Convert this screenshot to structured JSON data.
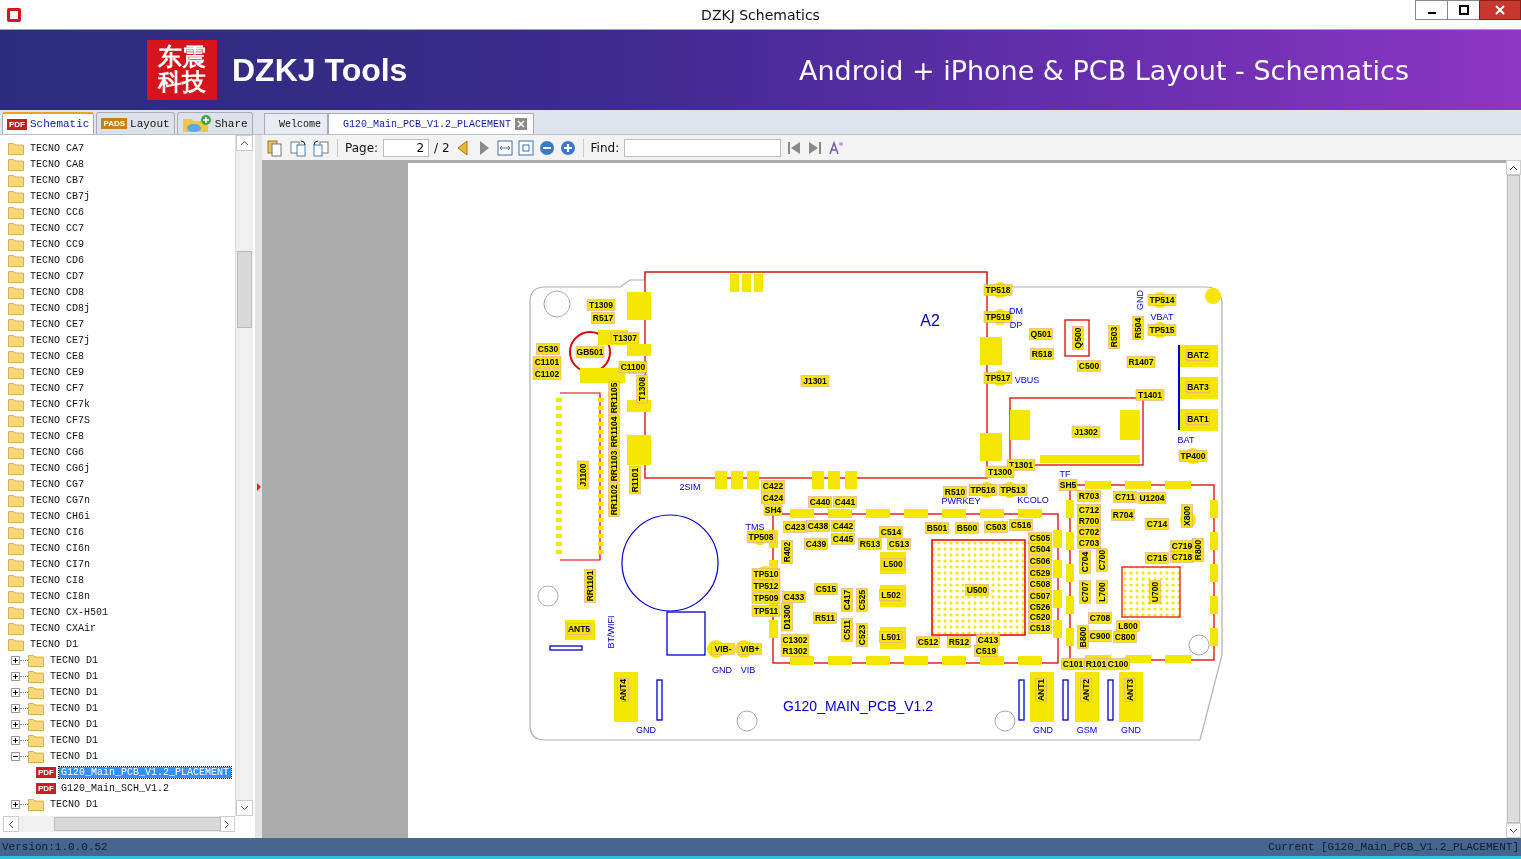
{
  "window": {
    "title": "DZKJ Schematics"
  },
  "banner": {
    "logo": "东震科技",
    "brand": "DZKJ Tools",
    "tagline": "Android + iPhone & PCB Layout - Schematics"
  },
  "panel_tabs": [
    {
      "kind": "schematic",
      "badge": "PDF",
      "label": "Schematic",
      "selected": true
    },
    {
      "kind": "layout",
      "badge": "PADS",
      "label": "Layout",
      "selected": false
    },
    {
      "kind": "share",
      "label": "Share",
      "selected": false
    }
  ],
  "document_tabs": [
    {
      "label": "Welcome",
      "selected": false,
      "closable": false
    },
    {
      "label": "G120_Main_PCB_V1.2_PLACEMENT",
      "selected": true,
      "closable": true
    }
  ],
  "tree": [
    {
      "kind": "folder",
      "label": "TECNO CA7",
      "selected": false
    },
    {
      "kind": "folder",
      "label": "TECNO CA8",
      "selected": false
    },
    {
      "kind": "folder",
      "label": "TECNO CB7",
      "selected": false
    },
    {
      "kind": "folder",
      "label": "TECNO CB7j",
      "selected": false
    },
    {
      "kind": "folder",
      "label": "TECNO CC6",
      "selected": false
    },
    {
      "kind": "folder",
      "label": "TECNO CC7",
      "selected": false
    },
    {
      "kind": "folder",
      "label": "TECNO CC9",
      "selected": false
    },
    {
      "kind": "folder",
      "label": "TECNO CD6",
      "selected": false
    },
    {
      "kind": "folder",
      "label": "TECNO CD7",
      "selected": false
    },
    {
      "kind": "folder",
      "label": "TECNO CD8",
      "selected": false
    },
    {
      "kind": "folder",
      "label": "TECNO CD8j",
      "selected": false
    },
    {
      "kind": "folder",
      "label": "TECNO CE7",
      "selected": false
    },
    {
      "kind": "folder",
      "label": "TECNO CE7j",
      "selected": false
    },
    {
      "kind": "folder",
      "label": "TECNO CE8",
      "selected": false
    },
    {
      "kind": "folder",
      "label": "TECNO CE9",
      "selected": false
    },
    {
      "kind": "folder",
      "label": "TECNO CF7",
      "selected": false
    },
    {
      "kind": "folder",
      "label": "TECNO CF7k",
      "selected": false
    },
    {
      "kind": "folder",
      "label": "TECNO CF7S",
      "selected": false
    },
    {
      "kind": "folder",
      "label": "TECNO CF8",
      "selected": false
    },
    {
      "kind": "folder",
      "label": "TECNO CG6",
      "selected": false
    },
    {
      "kind": "folder",
      "label": "TECNO CG6j",
      "selected": false
    },
    {
      "kind": "folder",
      "label": "TECNO CG7",
      "selected": false
    },
    {
      "kind": "folder",
      "label": "TECNO CG7n",
      "selected": false
    },
    {
      "kind": "folder",
      "label": "TECNO CH6i",
      "selected": false
    },
    {
      "kind": "folder",
      "label": "TECNO CI6",
      "selected": false
    },
    {
      "kind": "folder",
      "label": "TECNO CI6n",
      "selected": false
    },
    {
      "kind": "folder",
      "label": "TECNO CI7n",
      "selected": false
    },
    {
      "kind": "folder",
      "label": "TECNO CI8",
      "selected": false
    },
    {
      "kind": "folder",
      "label": "TECNO CI8n",
      "selected": false
    },
    {
      "kind": "folder",
      "label": "TECNO CX-H501",
      "selected": false
    },
    {
      "kind": "folder",
      "label": "TECNO CXAir",
      "selected": false
    },
    {
      "kind": "folder",
      "label": "TECNO D1",
      "selected": false,
      "children": [
        {
          "kind": "folder",
          "label": "TECNO D1",
          "expanded": false,
          "selected": false
        },
        {
          "kind": "folder",
          "label": "TECNO D1",
          "expanded": false,
          "selected": false
        },
        {
          "kind": "folder",
          "label": "TECNO D1",
          "expanded": false,
          "selected": false
        },
        {
          "kind": "folder",
          "label": "TECNO D1",
          "expanded": false,
          "selected": false
        },
        {
          "kind": "folder",
          "label": "TECNO D1",
          "expanded": false,
          "selected": false
        },
        {
          "kind": "folder",
          "label": "TECNO D1",
          "expanded": false,
          "selected": false
        },
        {
          "kind": "folder",
          "label": "TECNO D1",
          "expanded": true,
          "selected": false,
          "children": [
            {
              "kind": "file",
              "badge": "PDF",
              "label": "G120_Main_PCB_V1.2_PLACEMENT",
              "selected": true
            },
            {
              "kind": "file",
              "badge": "PDF",
              "label": "G120_Main_SCH_V1.2",
              "selected": false
            }
          ]
        },
        {
          "kind": "folder",
          "label": "TECNO D1",
          "expanded": false,
          "selected": false
        }
      ]
    }
  ],
  "toolbar": {
    "page_label": "Page:",
    "page": "2",
    "page_total": "/ 2",
    "find_label": "Find:"
  },
  "document": {
    "labels": [
      {
        "text": "T1309",
        "kind": "part"
      },
      {
        "text": "R517",
        "kind": "part"
      },
      {
        "text": "T1307",
        "kind": "part"
      },
      {
        "text": "GB501",
        "kind": "part"
      },
      {
        "text": "C530",
        "kind": "part"
      },
      {
        "text": "C1101",
        "kind": "part"
      },
      {
        "text": "C1102",
        "kind": "part"
      },
      {
        "text": "C1100",
        "kind": "part"
      },
      {
        "text": "T1308",
        "kind": "part"
      },
      {
        "text": "J1301",
        "kind": "part"
      },
      {
        "text": "A2",
        "kind": "net"
      },
      {
        "text": "J1100",
        "kind": "part"
      },
      {
        "text": "RR1105",
        "kind": "part"
      },
      {
        "text": "RR1104",
        "kind": "part"
      },
      {
        "text": "RR1103",
        "kind": "part"
      },
      {
        "text": "RR1102",
        "kind": "part"
      },
      {
        "text": "R1101",
        "kind": "part"
      },
      {
        "text": "RR1101",
        "kind": "part"
      },
      {
        "text": "2SIM",
        "kind": "net"
      },
      {
        "text": "BT/WIFI",
        "kind": "net"
      },
      {
        "text": "ANT5",
        "kind": "part"
      },
      {
        "text": "ANT4",
        "kind": "part"
      },
      {
        "text": "GND",
        "kind": "net"
      },
      {
        "text": "VIB-",
        "kind": "part"
      },
      {
        "text": "VIB+",
        "kind": "part"
      },
      {
        "text": "GND",
        "kind": "net"
      },
      {
        "text": "VIB",
        "kind": "net"
      },
      {
        "text": "G120_MAIN_PCB_V1.2",
        "kind": "net"
      },
      {
        "text": "TP518",
        "kind": "part"
      },
      {
        "text": "TP519",
        "kind": "part"
      },
      {
        "text": "DM",
        "kind": "net"
      },
      {
        "text": "DP",
        "kind": "net"
      },
      {
        "text": "TP517",
        "kind": "part"
      },
      {
        "text": "VBUS",
        "kind": "net"
      },
      {
        "text": "Q501",
        "kind": "part"
      },
      {
        "text": "R518",
        "kind": "part"
      },
      {
        "text": "Q500",
        "kind": "part"
      },
      {
        "text": "R503",
        "kind": "part"
      },
      {
        "text": "R504",
        "kind": "part"
      },
      {
        "text": "GND",
        "kind": "net"
      },
      {
        "text": "TP514",
        "kind": "part"
      },
      {
        "text": "VBAT",
        "kind": "net"
      },
      {
        "text": "TP515",
        "kind": "part"
      },
      {
        "text": "R1407",
        "kind": "part"
      },
      {
        "text": "C500",
        "kind": "part"
      },
      {
        "text": "T1401",
        "kind": "part"
      },
      {
        "text": "BAT2",
        "kind": "part"
      },
      {
        "text": "BAT3",
        "kind": "part"
      },
      {
        "text": "BAT1",
        "kind": "part"
      },
      {
        "text": "J1302",
        "kind": "part"
      },
      {
        "text": "BAT",
        "kind": "net"
      },
      {
        "text": "TP400",
        "kind": "part"
      },
      {
        "text": "T1301",
        "kind": "part"
      },
      {
        "text": "T1300",
        "kind": "part"
      },
      {
        "text": "TF",
        "kind": "net"
      },
      {
        "text": "SH5",
        "kind": "part"
      },
      {
        "text": "PWRKEY",
        "kind": "net"
      },
      {
        "text": "KCOLO",
        "kind": "net"
      },
      {
        "text": "R510",
        "kind": "part"
      },
      {
        "text": "TP516",
        "kind": "part"
      },
      {
        "text": "TP513",
        "kind": "part"
      },
      {
        "text": "C422",
        "kind": "part"
      },
      {
        "text": "C424",
        "kind": "part"
      },
      {
        "text": "SH4",
        "kind": "part"
      },
      {
        "text": "C440",
        "kind": "part"
      },
      {
        "text": "C441",
        "kind": "part"
      },
      {
        "text": "TMS",
        "kind": "net"
      },
      {
        "text": "TP508",
        "kind": "part"
      },
      {
        "text": "TP510",
        "kind": "part"
      },
      {
        "text": "TP512",
        "kind": "part"
      },
      {
        "text": "TP509",
        "kind": "part"
      },
      {
        "text": "TP511",
        "kind": "part"
      },
      {
        "text": "C423",
        "kind": "part"
      },
      {
        "text": "C438",
        "kind": "part"
      },
      {
        "text": "C442",
        "kind": "part"
      },
      {
        "text": "C439",
        "kind": "part"
      },
      {
        "text": "C445",
        "kind": "part"
      },
      {
        "text": "R402",
        "kind": "part"
      },
      {
        "text": "C433",
        "kind": "part"
      },
      {
        "text": "C515",
        "kind": "part"
      },
      {
        "text": "R511",
        "kind": "part"
      },
      {
        "text": "D1300",
        "kind": "part"
      },
      {
        "text": "C1302",
        "kind": "part"
      },
      {
        "text": "R1302",
        "kind": "part"
      },
      {
        "text": "C417",
        "kind": "part"
      },
      {
        "text": "C525",
        "kind": "part"
      },
      {
        "text": "C511",
        "kind": "part"
      },
      {
        "text": "C523",
        "kind": "part"
      },
      {
        "text": "C514",
        "kind": "part"
      },
      {
        "text": "R513",
        "kind": "part"
      },
      {
        "text": "C513",
        "kind": "part"
      },
      {
        "text": "L500",
        "kind": "part"
      },
      {
        "text": "L502",
        "kind": "part"
      },
      {
        "text": "L501",
        "kind": "part"
      },
      {
        "text": "C512",
        "kind": "part"
      },
      {
        "text": "R512",
        "kind": "part"
      },
      {
        "text": "C413",
        "kind": "part"
      },
      {
        "text": "C519",
        "kind": "part"
      },
      {
        "text": "U500",
        "kind": "part"
      },
      {
        "text": "B501",
        "kind": "part"
      },
      {
        "text": "B500",
        "kind": "part"
      },
      {
        "text": "C503",
        "kind": "part"
      },
      {
        "text": "C516",
        "kind": "part"
      },
      {
        "text": "C505",
        "kind": "part"
      },
      {
        "text": "C504",
        "kind": "part"
      },
      {
        "text": "C506",
        "kind": "part"
      },
      {
        "text": "C529",
        "kind": "part"
      },
      {
        "text": "C508",
        "kind": "part"
      },
      {
        "text": "C507",
        "kind": "part"
      },
      {
        "text": "C526",
        "kind": "part"
      },
      {
        "text": "C520",
        "kind": "part"
      },
      {
        "text": "C518",
        "kind": "part"
      },
      {
        "text": "R703",
        "kind": "part"
      },
      {
        "text": "C711",
        "kind": "part"
      },
      {
        "text": "U1204",
        "kind": "part"
      },
      {
        "text": "X800",
        "kind": "part"
      },
      {
        "text": "C712",
        "kind": "part"
      },
      {
        "text": "R700",
        "kind": "part"
      },
      {
        "text": "C702",
        "kind": "part"
      },
      {
        "text": "C703",
        "kind": "part"
      },
      {
        "text": "R704",
        "kind": "part"
      },
      {
        "text": "C714",
        "kind": "part"
      },
      {
        "text": "C715",
        "kind": "part"
      },
      {
        "text": "C719",
        "kind": "part"
      },
      {
        "text": "C718",
        "kind": "part"
      },
      {
        "text": "R800",
        "kind": "part"
      },
      {
        "text": "C704",
        "kind": "part"
      },
      {
        "text": "C700",
        "kind": "part"
      },
      {
        "text": "C707",
        "kind": "part"
      },
      {
        "text": "L700",
        "kind": "part"
      },
      {
        "text": "U700",
        "kind": "part"
      },
      {
        "text": "C708",
        "kind": "part"
      },
      {
        "text": "L800",
        "kind": "part"
      },
      {
        "text": "C900",
        "kind": "part"
      },
      {
        "text": "C800",
        "kind": "part"
      },
      {
        "text": "B800",
        "kind": "part"
      },
      {
        "text": "C101",
        "kind": "part"
      },
      {
        "text": "R101",
        "kind": "part"
      },
      {
        "text": "C100",
        "kind": "part"
      },
      {
        "text": "ANT1",
        "kind": "part"
      },
      {
        "text": "ANT2",
        "kind": "part"
      },
      {
        "text": "ANT3",
        "kind": "part"
      },
      {
        "text": "GND",
        "kind": "net"
      },
      {
        "text": "GSM",
        "kind": "net"
      },
      {
        "text": "GND",
        "kind": "net"
      }
    ]
  },
  "status_bar": {
    "version": "Version:1.0.0.52",
    "current": "Current [G120_Main_PCB_V1.2_PLACEMENT]"
  }
}
